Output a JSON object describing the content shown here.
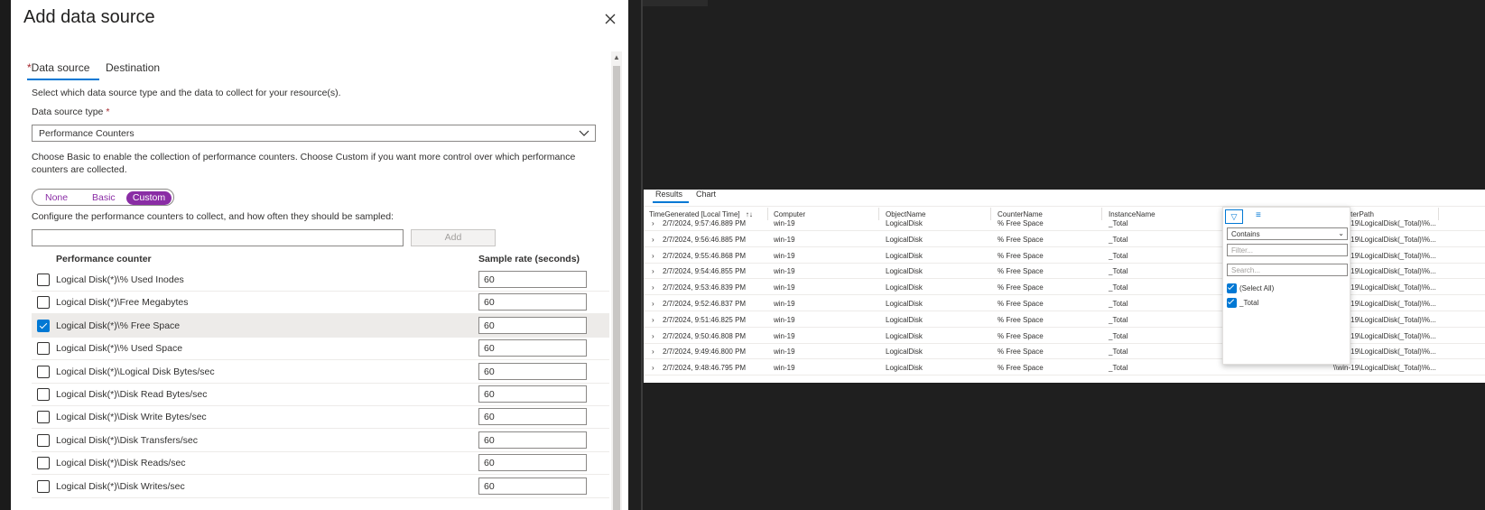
{
  "dialog": {
    "title": "Add data source",
    "tabs": [
      {
        "label": "Data source",
        "required_mark": "*"
      },
      {
        "label": "Destination"
      }
    ],
    "intro": "Select which data source type and the data to collect for your resource(s).",
    "type_label": "Data source type",
    "required_mark": "*",
    "type_value": "Performance Counters",
    "desc_line1": "Choose Basic to enable the collection of performance counters. Choose Custom if you want more control over which performance",
    "desc_line2": "counters are collected.",
    "modes": [
      "None",
      "Basic",
      "Custom"
    ],
    "selected_mode": "Custom",
    "configure_text": "Configure the performance counters to collect, and how often they should be sampled:",
    "add_label": "Add",
    "col_counter": "Performance counter",
    "col_rate": "Sample rate (seconds)",
    "counters": [
      {
        "name": "Logical Disk(*)\\% Used Inodes",
        "rate": "60",
        "checked": false
      },
      {
        "name": "Logical Disk(*)\\Free Megabytes",
        "rate": "60",
        "checked": false
      },
      {
        "name": "Logical Disk(*)\\% Free Space",
        "rate": "60",
        "checked": true
      },
      {
        "name": "Logical Disk(*)\\% Used Space",
        "rate": "60",
        "checked": false
      },
      {
        "name": "Logical Disk(*)\\Logical Disk Bytes/sec",
        "rate": "60",
        "checked": false
      },
      {
        "name": "Logical Disk(*)\\Disk Read Bytes/sec",
        "rate": "60",
        "checked": false
      },
      {
        "name": "Logical Disk(*)\\Disk Write Bytes/sec",
        "rate": "60",
        "checked": false
      },
      {
        "name": "Logical Disk(*)\\Disk Transfers/sec",
        "rate": "60",
        "checked": false
      },
      {
        "name": "Logical Disk(*)\\Disk Reads/sec",
        "rate": "60",
        "checked": false
      },
      {
        "name": "Logical Disk(*)\\Disk Writes/sec",
        "rate": "60",
        "checked": false
      }
    ]
  },
  "results": {
    "tabs": [
      "Results",
      "Chart"
    ],
    "columns": [
      "TimeGenerated [Local Time]",
      "Computer",
      "ObjectName",
      "CounterName",
      "InstanceName",
      "CounterPath"
    ],
    "sort_icon": "↑↓",
    "rows": [
      {
        "time": "2/7/2024, 9:57:46.889 PM",
        "computer": "win-19",
        "object": "LogicalDisk",
        "counter": "% Free Space",
        "instance": "_Total",
        "path": "\\\\win-19\\LogicalDisk(_Total)\\%..."
      },
      {
        "time": "2/7/2024, 9:56:46.885 PM",
        "computer": "win-19",
        "object": "LogicalDisk",
        "counter": "% Free Space",
        "instance": "_Total",
        "path": "\\\\win-19\\LogicalDisk(_Total)\\%..."
      },
      {
        "time": "2/7/2024, 9:55:46.868 PM",
        "computer": "win-19",
        "object": "LogicalDisk",
        "counter": "% Free Space",
        "instance": "_Total",
        "path": "\\\\win-19\\LogicalDisk(_Total)\\%..."
      },
      {
        "time": "2/7/2024, 9:54:46.855 PM",
        "computer": "win-19",
        "object": "LogicalDisk",
        "counter": "% Free Space",
        "instance": "_Total",
        "path": "\\\\win-19\\LogicalDisk(_Total)\\%..."
      },
      {
        "time": "2/7/2024, 9:53:46.839 PM",
        "computer": "win-19",
        "object": "LogicalDisk",
        "counter": "% Free Space",
        "instance": "_Total",
        "path": "\\\\win-19\\LogicalDisk(_Total)\\%..."
      },
      {
        "time": "2/7/2024, 9:52:46.837 PM",
        "computer": "win-19",
        "object": "LogicalDisk",
        "counter": "% Free Space",
        "instance": "_Total",
        "path": "\\\\win-19\\LogicalDisk(_Total)\\%..."
      },
      {
        "time": "2/7/2024, 9:51:46.825 PM",
        "computer": "win-19",
        "object": "LogicalDisk",
        "counter": "% Free Space",
        "instance": "_Total",
        "path": "\\\\win-19\\LogicalDisk(_Total)\\%..."
      },
      {
        "time": "2/7/2024, 9:50:46.808 PM",
        "computer": "win-19",
        "object": "LogicalDisk",
        "counter": "% Free Space",
        "instance": "_Total",
        "path": "\\\\win-19\\LogicalDisk(_Total)\\%..."
      },
      {
        "time": "2/7/2024, 9:49:46.800 PM",
        "computer": "win-19",
        "object": "LogicalDisk",
        "counter": "% Free Space",
        "instance": "_Total",
        "path": "\\\\win-19\\LogicalDisk(_Total)\\%..."
      },
      {
        "time": "2/7/2024, 9:48:46.795 PM",
        "computer": "win-19",
        "object": "LogicalDisk",
        "counter": "% Free Space",
        "instance": "_Total",
        "path": "\\\\win-19\\LogicalDisk(_Total)\\%..."
      }
    ],
    "filter": {
      "operator": "Contains",
      "filter_placeholder": "Filter...",
      "search_placeholder": "Search...",
      "options": [
        "(Select All)",
        "_Total"
      ],
      "filter_icon": "▽",
      "columns_icon": "≡"
    }
  },
  "colors": {
    "accent": "#0078d4",
    "toggle": "#8a2da5",
    "required": "#a4262c"
  },
  "icons": {
    "close": "close-icon",
    "chevron": "chevron-down-icon",
    "expand": "chevron-right-icon"
  }
}
